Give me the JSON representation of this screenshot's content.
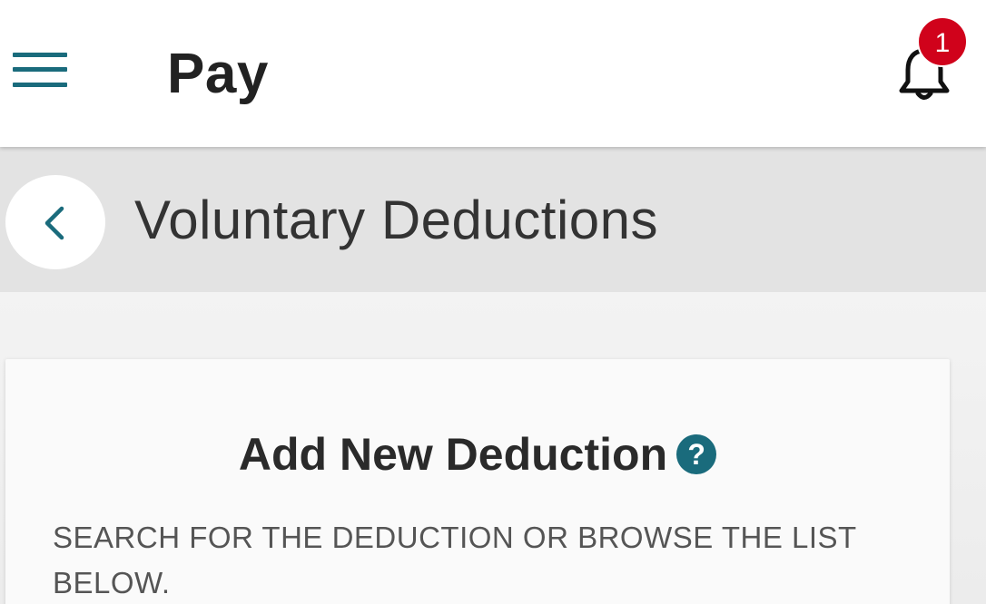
{
  "colors": {
    "accent": "#1a6b7c",
    "badge": "#d0021b",
    "header_bg": "#ffffff",
    "subheader_bg": "#e3e3e3"
  },
  "header": {
    "title": "Pay",
    "menu_icon": "hamburger-menu-icon",
    "notification_icon": "bell-icon",
    "notification_count": "1"
  },
  "subheader": {
    "back_icon": "chevron-left-icon",
    "title": "Voluntary Deductions"
  },
  "card": {
    "title": "Add New Deduction",
    "help_icon_glyph": "?",
    "help_icon": "question-circle-icon",
    "instructions": "SEARCH FOR THE DEDUCTION OR BROWSE THE LIST BELOW."
  }
}
